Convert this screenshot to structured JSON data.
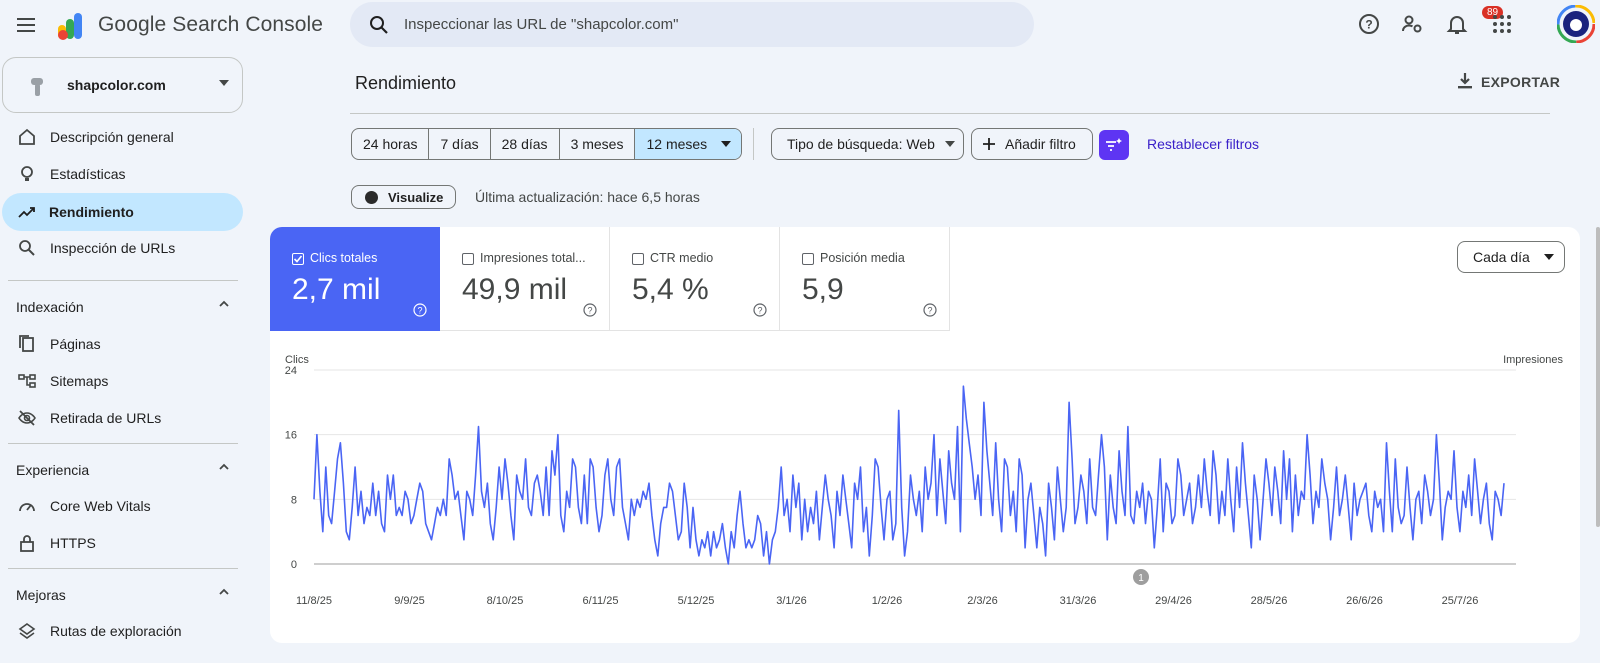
{
  "app": {
    "name": "Google Search Console"
  },
  "search": {
    "placeholder": "Inspeccionar las URL de \"shapcolor.com\""
  },
  "header": {
    "notification_count": "89"
  },
  "property": {
    "name": "shapcolor.com"
  },
  "sidebar": {
    "top_items": [
      {
        "label": "Descripción general",
        "icon": "home-icon"
      },
      {
        "label": "Estadísticas",
        "icon": "lightbulb-icon"
      },
      {
        "label": "Rendimiento",
        "icon": "trending-up-icon",
        "active": true
      },
      {
        "label": "Inspección de URLs",
        "icon": "search-icon"
      }
    ],
    "sections": [
      {
        "title": "Indexación",
        "items": [
          {
            "label": "Páginas",
            "icon": "pages-icon"
          },
          {
            "label": "Sitemaps",
            "icon": "sitemap-icon"
          },
          {
            "label": "Retirada de URLs",
            "icon": "eye-off-icon"
          }
        ]
      },
      {
        "title": "Experiencia",
        "items": [
          {
            "label": "Core Web Vitals",
            "icon": "speed-icon"
          },
          {
            "label": "HTTPS",
            "icon": "lock-icon"
          }
        ]
      },
      {
        "title": "Mejoras",
        "items": [
          {
            "label": "Rutas de exploración",
            "icon": "layers-icon"
          }
        ]
      }
    ]
  },
  "main": {
    "title": "Rendimiento",
    "export_label": "EXPORTAR",
    "date_ranges": [
      "24 horas",
      "7 días",
      "28 días",
      "3 meses",
      "12 meses"
    ],
    "selected_range": "12 meses",
    "search_type": "Tipo de búsqueda: Web",
    "add_filter": "Añadir filtro",
    "reset_filters": "Restablecer filtros",
    "visualize": "Visualize",
    "last_update": "Última actualización: hace 6,5 horas"
  },
  "metrics": [
    {
      "label": "Clics totales",
      "value": "2,7 mil",
      "active": true
    },
    {
      "label": "Impresiones total...",
      "value": "49,9 mil",
      "active": false
    },
    {
      "label": "CTR medio",
      "value": "5,4 %",
      "active": false
    },
    {
      "label": "Posición media",
      "value": "5,9",
      "active": false
    }
  ],
  "granularity": "Cada día",
  "colors": {
    "accent": "#4a65f4",
    "selected_chip": "#c2e7ff",
    "filter_button": "#5e35f3"
  },
  "chart_data": {
    "type": "line",
    "left_axis_title": "Clics",
    "right_axis_title": "Impresiones",
    "ylim": [
      0,
      24
    ],
    "yticks": [
      0,
      8,
      16,
      24
    ],
    "grid": true,
    "x_tick_labels": [
      "11/8/25",
      "9/9/25",
      "8/10/25",
      "6/11/25",
      "5/12/25",
      "3/1/26",
      "1/2/26",
      "2/3/26",
      "31/3/26",
      "29/4/26",
      "28/5/26",
      "26/6/26",
      "25/7/26"
    ],
    "x_start": "2025-08-11",
    "annotation": {
      "label": "1",
      "date": "2026-04-21"
    },
    "series": [
      {
        "name": "Clics totales",
        "color": "#4a65f4",
        "values": [
          8,
          16,
          9,
          4,
          12,
          6,
          5,
          9,
          13,
          15,
          10,
          4,
          3,
          7,
          12,
          6,
          9,
          5,
          7,
          6,
          10,
          6,
          9,
          5,
          4,
          11,
          8,
          11,
          6,
          7,
          6,
          9,
          8,
          5,
          6,
          8,
          10,
          9,
          5,
          4,
          3,
          5,
          7,
          6,
          8,
          6,
          13,
          11,
          8,
          9,
          6,
          3,
          9,
          8,
          6,
          11,
          17,
          9,
          7,
          10,
          5,
          3,
          7,
          12,
          8,
          13,
          10,
          6,
          3,
          11,
          9,
          8,
          13,
          7,
          6,
          10,
          11,
          9,
          6,
          12,
          6,
          14,
          11,
          16,
          6,
          4,
          9,
          7,
          13,
          12,
          7,
          5,
          11,
          5,
          13,
          12,
          7,
          4,
          6,
          11,
          13,
          8,
          6,
          12,
          13,
          7,
          5,
          3,
          8,
          6,
          8,
          7,
          9,
          8,
          10,
          6,
          3,
          1,
          5,
          7,
          7,
          10,
          9,
          6,
          3,
          4,
          10,
          7,
          2,
          7,
          3,
          1,
          3,
          2,
          4,
          1,
          4,
          2,
          3,
          5,
          2,
          0,
          4,
          2,
          6,
          9,
          5,
          2,
          3,
          2,
          3,
          6,
          5,
          1,
          4,
          0,
          3,
          4,
          7,
          12,
          6,
          8,
          4,
          11,
          7,
          10,
          3,
          8,
          4,
          7,
          5,
          9,
          3,
          7,
          11,
          8,
          6,
          2,
          9,
          6,
          11,
          8,
          5,
          2,
          10,
          8,
          12,
          4,
          7,
          1,
          6,
          13,
          12,
          7,
          3,
          8,
          9,
          3,
          5,
          19,
          7,
          1,
          4,
          11,
          8,
          6,
          9,
          4,
          12,
          8,
          10,
          16,
          6,
          13,
          9,
          5,
          14,
          10,
          8,
          17,
          4,
          22,
          18,
          15,
          12,
          8,
          11,
          6,
          20,
          14,
          10,
          6,
          15,
          8,
          4,
          13,
          12,
          6,
          9,
          4,
          13,
          11,
          2,
          8,
          10,
          6,
          2,
          7,
          5,
          1,
          10,
          7,
          3,
          12,
          8,
          4,
          7,
          20,
          13,
          5,
          7,
          11,
          9,
          5,
          13,
          7,
          6,
          11,
          16,
          12,
          3,
          11,
          7,
          5,
          14,
          9,
          6,
          17,
          6,
          5,
          9,
          7,
          10,
          5,
          9,
          8,
          2,
          7,
          13,
          4,
          10,
          9,
          5,
          6,
          13,
          11,
          6,
          8,
          10,
          5,
          7,
          11,
          7,
          13,
          9,
          6,
          14,
          11,
          5,
          9,
          6,
          13,
          8,
          4,
          12,
          7,
          15,
          10,
          6,
          2,
          11,
          8,
          3,
          8,
          13,
          10,
          6,
          12,
          9,
          5,
          14,
          8,
          13,
          4,
          11,
          6,
          9,
          8,
          16,
          11,
          5,
          9,
          7,
          13,
          10,
          8,
          3,
          7,
          12,
          6,
          8,
          11,
          7,
          3,
          10,
          6,
          8,
          9,
          10,
          6,
          4,
          9,
          7,
          8,
          4,
          15,
          9,
          4,
          13,
          7,
          5,
          6,
          12,
          7,
          3,
          8,
          9,
          5,
          11,
          9,
          6,
          8,
          16,
          10,
          3,
          7,
          9,
          8,
          14,
          7,
          4,
          9,
          7,
          11,
          6,
          13,
          9,
          5,
          8,
          10,
          5,
          3,
          9,
          8,
          6,
          10
        ]
      }
    ]
  }
}
